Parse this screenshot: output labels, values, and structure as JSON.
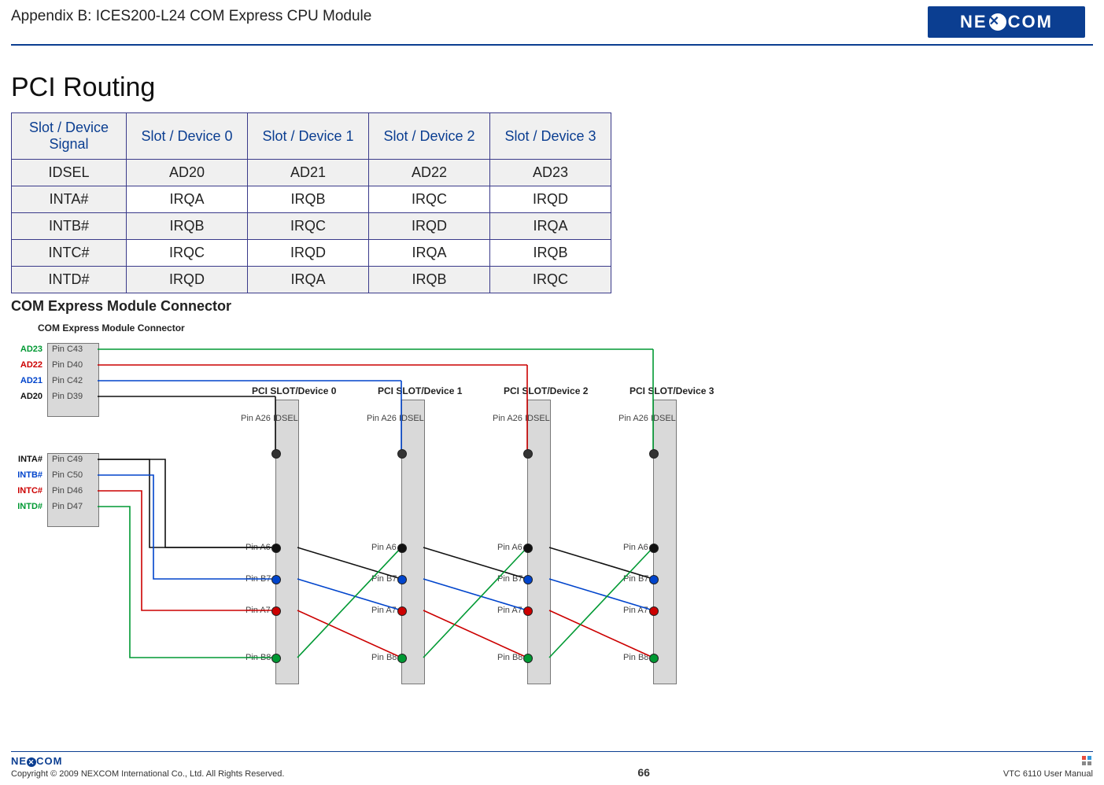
{
  "header": {
    "appendix": "Appendix B: ICES200-L24 COM Express CPU Module",
    "brand": "NEXCOM"
  },
  "section_title": "PCI Routing",
  "table": {
    "headers": [
      "Slot / Device Signal",
      "Slot / Device 0",
      "Slot / Device 1",
      "Slot / Device 2",
      "Slot / Device 3"
    ],
    "rows": [
      [
        "IDSEL",
        "AD20",
        "AD21",
        "AD22",
        "AD23"
      ],
      [
        "INTA#",
        "IRQA",
        "IRQB",
        "IRQC",
        "IRQD"
      ],
      [
        "INTB#",
        "IRQB",
        "IRQC",
        "IRQD",
        "IRQA"
      ],
      [
        "INTC#",
        "IRQC",
        "IRQD",
        "IRQA",
        "IRQB"
      ],
      [
        "INTD#",
        "IRQD",
        "IRQA",
        "IRQB",
        "IRQC"
      ]
    ]
  },
  "subsection": "COM Express Module Connector",
  "diagram": {
    "title": "COM Express Module Connector",
    "left_block1": [
      {
        "color": "#009933",
        "sig": "AD23",
        "pin": "Pin C43"
      },
      {
        "color": "#cc0000",
        "sig": "AD22",
        "pin": "Pin D40"
      },
      {
        "color": "#0044cc",
        "sig": "AD21",
        "pin": "Pin C42"
      },
      {
        "color": "#111111",
        "sig": "AD20",
        "pin": "Pin D39"
      }
    ],
    "left_block2": [
      {
        "color": "#111111",
        "sig": "INTA#",
        "pin": "Pin C49"
      },
      {
        "color": "#0044cc",
        "sig": "INTB#",
        "pin": "Pin C50"
      },
      {
        "color": "#cc0000",
        "sig": "INTC#",
        "pin": "Pin D46"
      },
      {
        "color": "#009933",
        "sig": "INTD#",
        "pin": "Pin D47"
      }
    ],
    "slots": [
      {
        "label": "PCI SLOT/Device 0"
      },
      {
        "label": "PCI SLOT/Device 1"
      },
      {
        "label": "PCI SLOT/Device 2"
      },
      {
        "label": "PCI SLOT/Device 3"
      }
    ],
    "slot_pins_top": "Pin A26 IDSEL",
    "slot_pins": [
      "Pin A6",
      "Pin B7",
      "Pin A7",
      "Pin B8"
    ]
  },
  "footer": {
    "copyright": "Copyright © 2009 NEXCOM International Co., Ltd. All Rights Reserved.",
    "page": "66",
    "manual": "VTC 6110 User Manual"
  }
}
